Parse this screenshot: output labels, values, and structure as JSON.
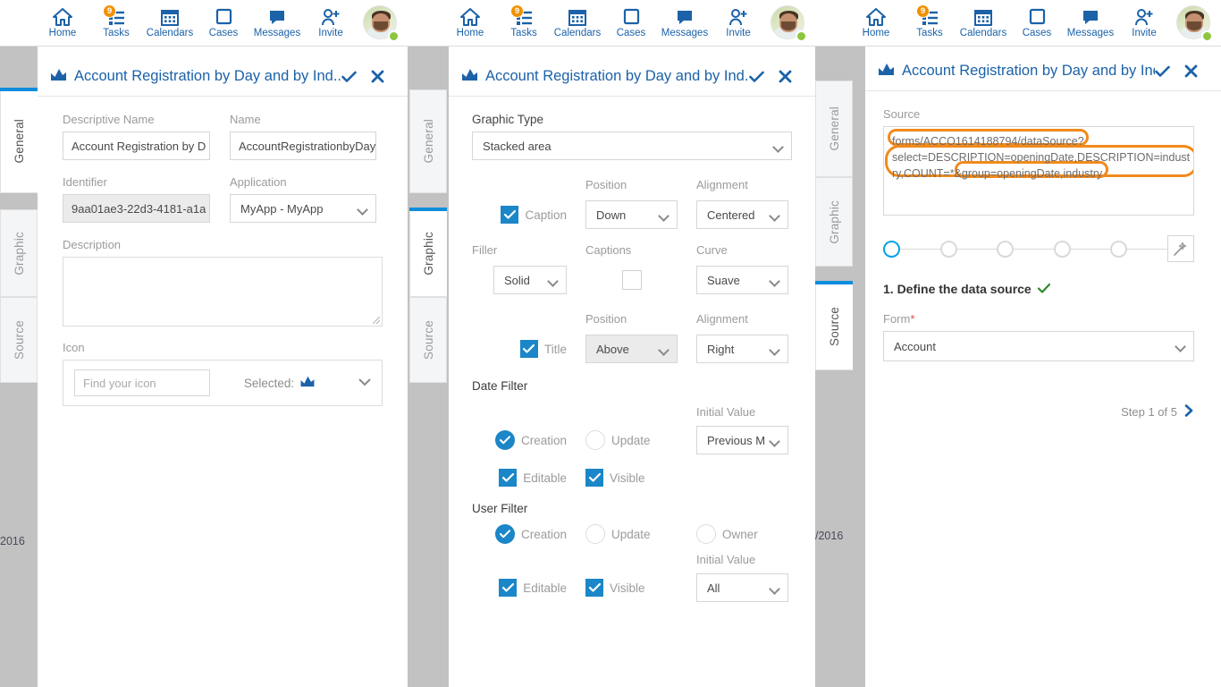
{
  "topnav": {
    "items": [
      {
        "label": "Home",
        "icon": "home-icon",
        "badge": null
      },
      {
        "label": "Tasks",
        "icon": "tasks-icon",
        "badge": "9"
      },
      {
        "label": "Calendars",
        "icon": "calendar-icon",
        "badge": null
      },
      {
        "label": "Cases",
        "icon": "cases-icon",
        "badge": null
      },
      {
        "label": "Messages",
        "icon": "messages-icon",
        "badge": null
      },
      {
        "label": "Invite",
        "icon": "invite-icon",
        "badge": null
      }
    ],
    "avatar": {
      "name": "avatar",
      "status": "online"
    }
  },
  "dialog": {
    "title": "Account Registration by Day and by Ind...",
    "title_icon": "area-chart-icon",
    "confirm_icon": "check-icon",
    "close_icon": "close-icon",
    "tabs": [
      "General",
      "Graphic",
      "Source"
    ]
  },
  "general": {
    "descriptive_name": {
      "label": "Descriptive Name",
      "value": "Account Registration by D"
    },
    "name": {
      "label": "Name",
      "value": "AccountRegistrationbyDay"
    },
    "identifier": {
      "label": "Identifier",
      "value": "9aa01ae3-22d3-4181-a1a"
    },
    "application": {
      "label": "Application",
      "value": "MyApp - MyApp"
    },
    "description": {
      "label": "Description",
      "value": ""
    },
    "icon": {
      "label": "Icon",
      "placeholder": "Find your icon",
      "selected_label": "Selected:",
      "selected_icon": "area-chart-icon"
    }
  },
  "graphic": {
    "graphic_type": {
      "label": "Graphic Type",
      "value": "Stacked area"
    },
    "caption": {
      "label": "Caption",
      "checked": true
    },
    "caption_position": {
      "label": "Position",
      "value": "Down"
    },
    "caption_alignment": {
      "label": "Alignment",
      "value": "Centered"
    },
    "filler": {
      "label": "Filler",
      "value": "Solid"
    },
    "captions": {
      "label": "Captions",
      "checked": false
    },
    "curve": {
      "label": "Curve",
      "value": "Suave"
    },
    "title": {
      "label": "Title",
      "checked": true
    },
    "title_position": {
      "label": "Position",
      "value": "Above"
    },
    "title_alignment": {
      "label": "Alignment",
      "value": "Right"
    },
    "date_filter": {
      "label": "Date Filter",
      "creation": {
        "label": "Creation",
        "selected": true
      },
      "update": {
        "label": "Update",
        "selected": false
      },
      "initial_value": {
        "label": "Initial Value",
        "value": "Previous M"
      },
      "editable": {
        "label": "Editable",
        "checked": true
      },
      "visible": {
        "label": "Visible",
        "checked": true
      }
    },
    "user_filter": {
      "label": "User Filter",
      "creation": {
        "label": "Creation",
        "selected": true
      },
      "update": {
        "label": "Update",
        "selected": false
      },
      "owner": {
        "label": "Owner",
        "selected": false
      },
      "initial_value": {
        "label": "Initial Value",
        "value": "All"
      },
      "editable": {
        "label": "Editable",
        "checked": true
      },
      "visible": {
        "label": "Visible",
        "checked": true
      }
    }
  },
  "source": {
    "label": "Source",
    "lines": [
      "forms/ACCO1614188794/dataSource?",
      "select=DESCRIPTION=openingDate,DESCRIPTION=indust",
      "ry,COUNT=*&group=openingDate,industry"
    ],
    "highlight_color": "#f18a1c",
    "stepper": {
      "total": 5,
      "active_index": 0,
      "wand_icon": "magic-wand-icon"
    },
    "step_title": "1. Define the data source",
    "step_title_check": "check-icon",
    "form": {
      "label": "Form",
      "required": "*",
      "value": "Account"
    },
    "footer": {
      "text": "Step 1 of 5",
      "next_icon": "chevron-right-icon"
    }
  },
  "behind": {
    "left_fragment": "2016",
    "right_fragment": "/2016"
  },
  "colors": {
    "brand_blue": "#1b62a8",
    "accent_blue": "#0d8ddb",
    "checkbox_blue": "#1b86c8",
    "annotation_orange": "#f18a1c",
    "status_green": "#8cc63e",
    "badge_orange": "#f29100",
    "backdrop_gray": "#c2c2c2"
  }
}
